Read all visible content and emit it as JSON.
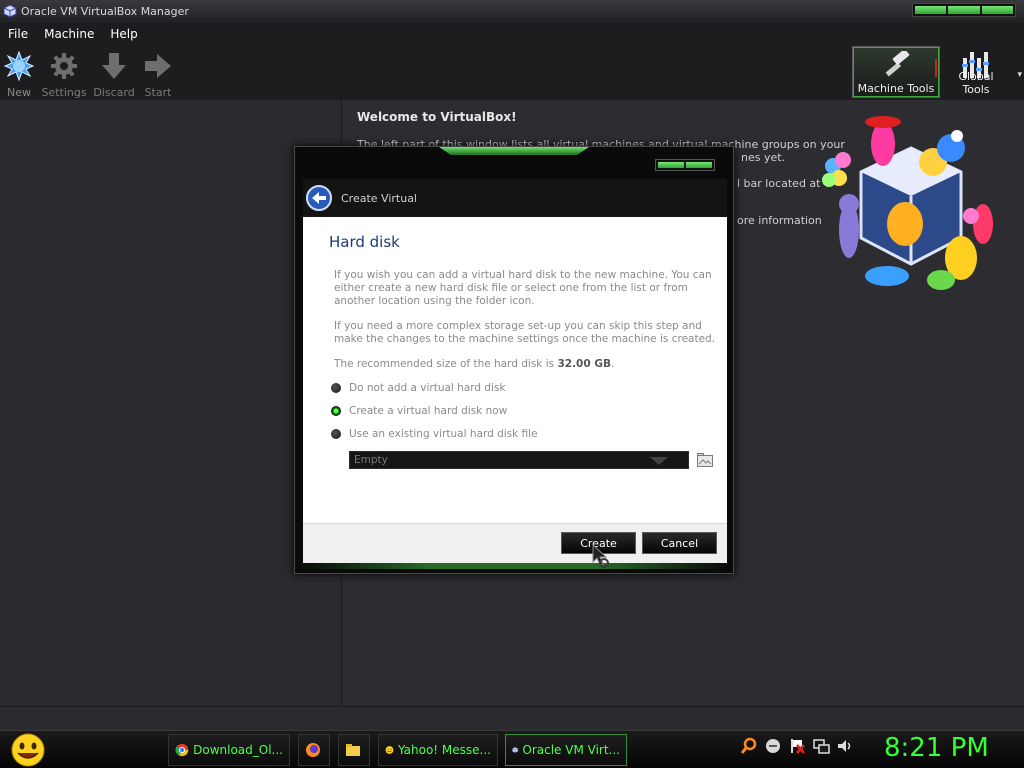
{
  "window": {
    "title": "Oracle VM VirtualBox Manager"
  },
  "menu": [
    "File",
    "Machine",
    "Help"
  ],
  "toolbar": {
    "new": "New",
    "settings": "Settings",
    "discard": "Discard",
    "start": "Start",
    "machine_tools": "Machine Tools",
    "global_tools": "Global Tools"
  },
  "welcome": {
    "title": "Welcome to VirtualBox!",
    "line1": "The left part of this window lists all virtual machines and virtual machine groups on your",
    "line2": "nes yet.",
    "line3": "l bar located at",
    "line4": "ore information"
  },
  "dialog": {
    "header": "Create Virtual",
    "page_title": "Hard disk",
    "para1": "If you wish you can add a virtual hard disk to the new machine. You can either create a new hard disk file or select one from the list or from another location using the folder icon.",
    "para2": "If you need a more complex storage set-up you can skip this step and make the changes to the machine settings once the machine is created.",
    "rec_prefix": "The recommended size of the hard disk is ",
    "rec_size": "32.00 GB",
    "rec_suffix": ".",
    "option_none": "Do not add a virtual hard disk",
    "option_create": "Create a virtual hard disk now",
    "option_existing": "Use an existing virtual hard disk file",
    "selected_option": "create",
    "existing_file": "Empty",
    "create_button": "Create",
    "cancel_button": "Cancel"
  },
  "taskbar": {
    "items": [
      "Download_Ol...",
      "Yahoo! Messe...",
      "Oracle VM Virt..."
    ],
    "clock": "8:21 PM"
  },
  "colors": {
    "accent_green": "#4cff4c",
    "page_title_blue": "#1c3a7a",
    "background": "#2d2d31"
  }
}
